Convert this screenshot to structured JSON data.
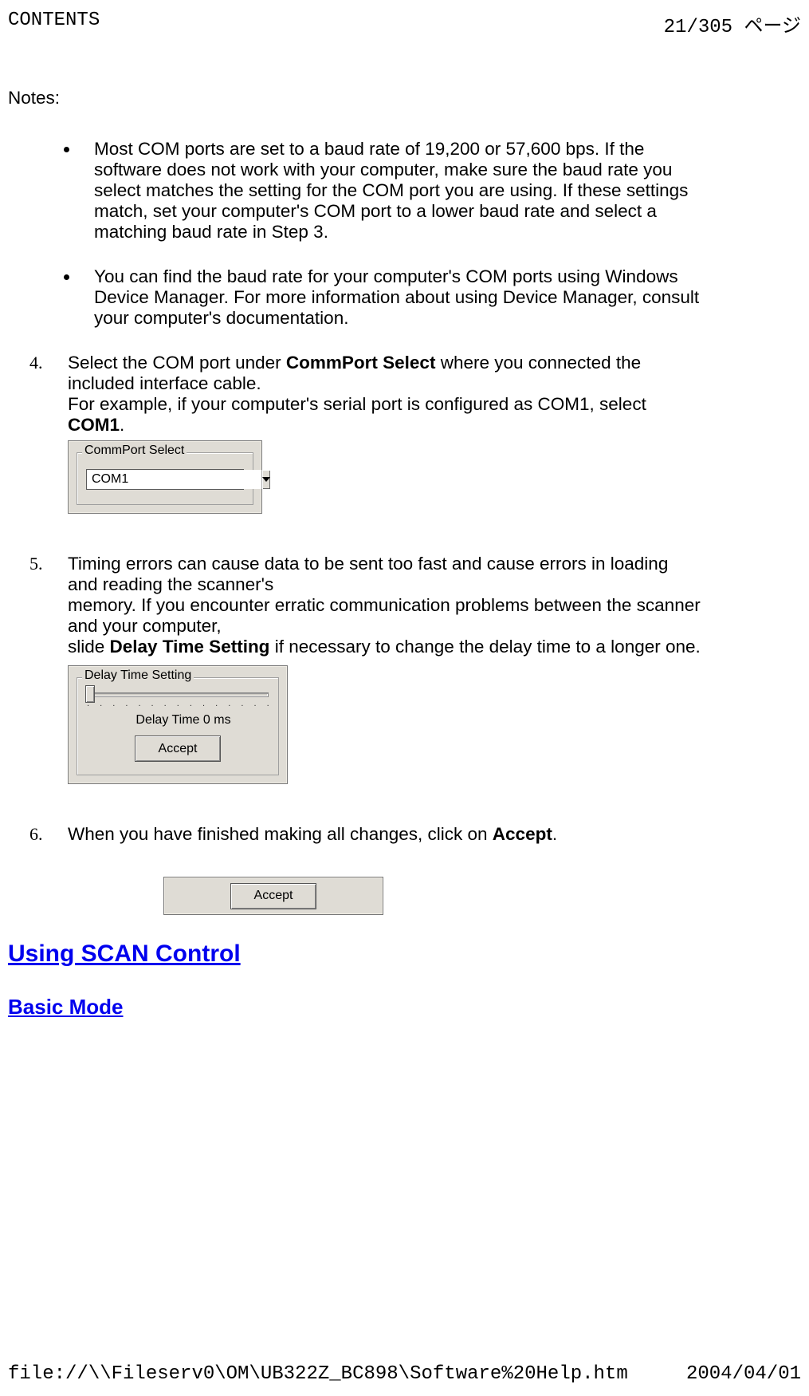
{
  "header": {
    "left": "CONTENTS",
    "right": "21/305 ページ"
  },
  "notes": {
    "label": "Notes:",
    "bullets": [
      "Most COM ports are set to a baud rate of 19,200 or 57,600 bps. If the software does not work with your\ncomputer, make sure the baud rate you select matches the setting for the COM port you are using.\nIf these settings match, set your computer's COM port to a lower baud rate and select a matching baud\nrate in Step 3.",
      "You can find the baud rate for your computer's COM ports using Windows Device Manager. For more\ninformation about using Device Manager, consult your computer's documentation."
    ]
  },
  "steps": {
    "four": {
      "marker": "4.",
      "pre1": "Select the COM port under ",
      "bold1": "CommPort Select",
      "post1": " where you connected the included interface cable.",
      "line2a": "For example, if your computer's serial port is configured as COM1, select ",
      "bold2": "COM1",
      "line2b": "."
    },
    "five": {
      "marker": "5.",
      "line1": "Timing errors can cause data to be sent too fast and cause errors in loading and reading the scanner's",
      "line2": "memory. If you encounter erratic communication problems between the scanner and your computer,",
      "line3a": "slide ",
      "bold1": "Delay Time Setting",
      "line3b": " if necessary to change the delay time to a longer one."
    },
    "six": {
      "marker": "6.",
      "pre": "When you have finished making all changes, click on ",
      "bold": "Accept",
      "post": "."
    }
  },
  "figures": {
    "commport": {
      "legend": "CommPort Select",
      "value": "COM1"
    },
    "delay": {
      "legend": "Delay Time Setting",
      "ticks": ". . . . . . . . . . . . . . . . . . . . .",
      "readout": "Delay Time  0 ms",
      "button": "Accept"
    },
    "accept": {
      "button": "Accept"
    }
  },
  "headings": {
    "h1": "Using SCAN Control",
    "h2": "Basic Mode"
  },
  "footer": {
    "left": "file://\\\\Fileserv0\\OM\\UB322Z_BC898\\Software%20Help.htm",
    "right": "2004/04/01"
  }
}
